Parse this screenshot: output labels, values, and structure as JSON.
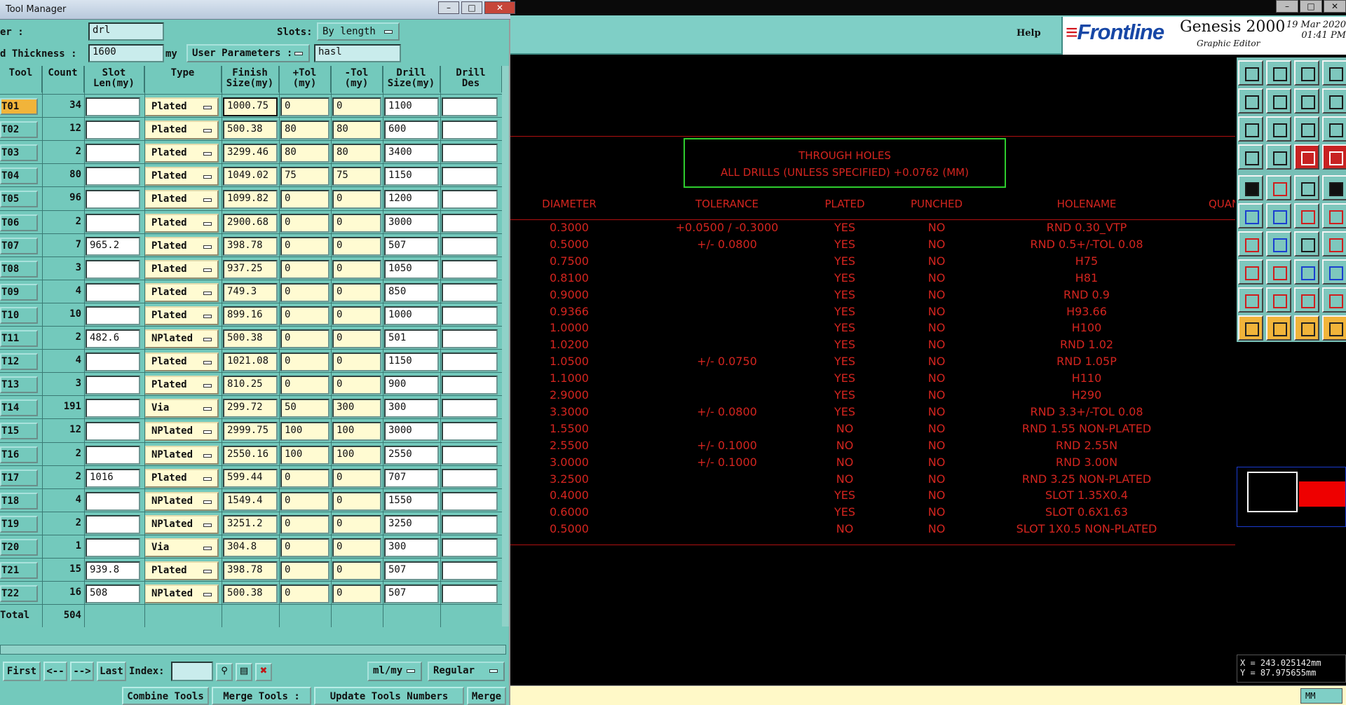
{
  "window_controls": {
    "min": "–",
    "max": "□",
    "close": "✕"
  },
  "genesis": {
    "help_label": "Help",
    "brand": "Frontline",
    "title": "Genesis 2000",
    "subtitle": "Graphic Editor",
    "date": "19 Mar 2020",
    "time": "01:41 PM",
    "colors": {
      "accent": "#7fcfc6",
      "drawing": "#d4251f",
      "frame": "#2ecc2e"
    },
    "drawing_title_line1": "THROUGH HOLES",
    "drawing_title_line2": "ALL DRILLS (UNLESS SPECIFIED) +0.0762 (MM)",
    "table_headers": [
      "DIAMETER",
      "TOLERANCE",
      "PLATED",
      "PUNCHED",
      "HOLENAME",
      "QUAN"
    ],
    "table_rows": [
      [
        "0.3000",
        "+0.0500 / -0.3000",
        "YES",
        "NO",
        "RND 0.30_VTP"
      ],
      [
        "0.5000",
        "+/- 0.0800",
        "YES",
        "NO",
        "RND 0.5+/-TOL 0.08"
      ],
      [
        "0.7500",
        "",
        "YES",
        "NO",
        "H75"
      ],
      [
        "0.8100",
        "",
        "YES",
        "NO",
        "H81"
      ],
      [
        "0.9000",
        "",
        "YES",
        "NO",
        "RND 0.9"
      ],
      [
        "0.9366",
        "",
        "YES",
        "NO",
        "H93.66"
      ],
      [
        "1.0000",
        "",
        "YES",
        "NO",
        "H100"
      ],
      [
        "1.0200",
        "",
        "YES",
        "NO",
        "RND 1.02"
      ],
      [
        "1.0500",
        "+/- 0.0750",
        "YES",
        "NO",
        "RND 1.05P"
      ],
      [
        "1.1000",
        "",
        "YES",
        "NO",
        "H110"
      ],
      [
        "2.9000",
        "",
        "YES",
        "NO",
        "H290"
      ],
      [
        "3.3000",
        "+/- 0.0800",
        "YES",
        "NO",
        "RND 3.3+/-TOL 0.08"
      ],
      [
        "1.5500",
        "",
        "NO",
        "NO",
        "RND 1.55 NON-PLATED"
      ],
      [
        "2.5500",
        "+/- 0.1000",
        "NO",
        "NO",
        "RND 2.55N"
      ],
      [
        "3.0000",
        "+/- 0.1000",
        "NO",
        "NO",
        "RND 3.00N"
      ],
      [
        "3.2500",
        "",
        "NO",
        "NO",
        "RND 3.25 NON-PLATED"
      ],
      [
        "0.4000",
        "",
        "YES",
        "NO",
        "SLOT 1.35X0.4"
      ],
      [
        "0.6000",
        "",
        "YES",
        "NO",
        "SLOT 0.6X1.63"
      ],
      [
        "0.5000",
        "",
        "NO",
        "NO",
        "SLOT 1X0.5 NON-PLATED"
      ]
    ],
    "coord_x": "X = 243.025142mm",
    "coord_y": "Y =  87.975655mm",
    "units_button": "MM"
  },
  "tool_manager": {
    "title": "Tool Manager",
    "layer_label": "er :",
    "layer_value": "drl",
    "slots_label": "Slots:",
    "slots_value": "By length",
    "thickness_label": "d Thickness :",
    "thickness_value": "1600",
    "thickness_unit": "my",
    "user_params_label": "User Parameters :",
    "user_params_value": "hasl",
    "columns": [
      "Tool",
      "Count",
      "Slot\nLen(my)",
      "Type",
      "Finish\nSize(my)",
      "+Tol\n(my)",
      "-Tol\n(my)",
      "Drill\nSize(my)",
      "Drill\nDes"
    ],
    "rows": [
      {
        "tool": "T01",
        "count": "34",
        "slot": "",
        "type": "Plated",
        "finish": "1000.75",
        "ptol": "0",
        "mtol": "0",
        "drill": "1100",
        "des": ""
      },
      {
        "tool": "T02",
        "count": "12",
        "slot": "",
        "type": "Plated",
        "finish": "500.38",
        "ptol": "80",
        "mtol": "80",
        "drill": "600",
        "des": ""
      },
      {
        "tool": "T03",
        "count": "2",
        "slot": "",
        "type": "Plated",
        "finish": "3299.46",
        "ptol": "80",
        "mtol": "80",
        "drill": "3400",
        "des": ""
      },
      {
        "tool": "T04",
        "count": "80",
        "slot": "",
        "type": "Plated",
        "finish": "1049.02",
        "ptol": "75",
        "mtol": "75",
        "drill": "1150",
        "des": ""
      },
      {
        "tool": "T05",
        "count": "96",
        "slot": "",
        "type": "Plated",
        "finish": "1099.82",
        "ptol": "0",
        "mtol": "0",
        "drill": "1200",
        "des": ""
      },
      {
        "tool": "T06",
        "count": "2",
        "slot": "",
        "type": "Plated",
        "finish": "2900.68",
        "ptol": "0",
        "mtol": "0",
        "drill": "3000",
        "des": ""
      },
      {
        "tool": "T07",
        "count": "7",
        "slot": "965.2",
        "type": "Plated",
        "finish": "398.78",
        "ptol": "0",
        "mtol": "0",
        "drill": "507",
        "des": ""
      },
      {
        "tool": "T08",
        "count": "3",
        "slot": "",
        "type": "Plated",
        "finish": "937.25",
        "ptol": "0",
        "mtol": "0",
        "drill": "1050",
        "des": ""
      },
      {
        "tool": "T09",
        "count": "4",
        "slot": "",
        "type": "Plated",
        "finish": "749.3",
        "ptol": "0",
        "mtol": "0",
        "drill": "850",
        "des": ""
      },
      {
        "tool": "T10",
        "count": "10",
        "slot": "",
        "type": "Plated",
        "finish": "899.16",
        "ptol": "0",
        "mtol": "0",
        "drill": "1000",
        "des": ""
      },
      {
        "tool": "T11",
        "count": "2",
        "slot": "482.6",
        "type": "NPlated",
        "finish": "500.38",
        "ptol": "0",
        "mtol": "0",
        "drill": "501",
        "des": ""
      },
      {
        "tool": "T12",
        "count": "4",
        "slot": "",
        "type": "Plated",
        "finish": "1021.08",
        "ptol": "0",
        "mtol": "0",
        "drill": "1150",
        "des": ""
      },
      {
        "tool": "T13",
        "count": "3",
        "slot": "",
        "type": "Plated",
        "finish": "810.25",
        "ptol": "0",
        "mtol": "0",
        "drill": "900",
        "des": ""
      },
      {
        "tool": "T14",
        "count": "191",
        "slot": "",
        "type": "Via",
        "finish": "299.72",
        "ptol": "50",
        "mtol": "300",
        "drill": "300",
        "des": ""
      },
      {
        "tool": "T15",
        "count": "12",
        "slot": "",
        "type": "NPlated",
        "finish": "2999.75",
        "ptol": "100",
        "mtol": "100",
        "drill": "3000",
        "des": ""
      },
      {
        "tool": "T16",
        "count": "2",
        "slot": "",
        "type": "NPlated",
        "finish": "2550.16",
        "ptol": "100",
        "mtol": "100",
        "drill": "2550",
        "des": ""
      },
      {
        "tool": "T17",
        "count": "2",
        "slot": "1016",
        "type": "Plated",
        "finish": "599.44",
        "ptol": "0",
        "mtol": "0",
        "drill": "707",
        "des": ""
      },
      {
        "tool": "T18",
        "count": "4",
        "slot": "",
        "type": "NPlated",
        "finish": "1549.4",
        "ptol": "0",
        "mtol": "0",
        "drill": "1550",
        "des": ""
      },
      {
        "tool": "T19",
        "count": "2",
        "slot": "",
        "type": "NPlated",
        "finish": "3251.2",
        "ptol": "0",
        "mtol": "0",
        "drill": "3250",
        "des": ""
      },
      {
        "tool": "T20",
        "count": "1",
        "slot": "",
        "type": "Via",
        "finish": "304.8",
        "ptol": "0",
        "mtol": "0",
        "drill": "300",
        "des": ""
      },
      {
        "tool": "T21",
        "count": "15",
        "slot": "939.8",
        "type": "Plated",
        "finish": "398.78",
        "ptol": "0",
        "mtol": "0",
        "drill": "507",
        "des": ""
      },
      {
        "tool": "T22",
        "count": "16",
        "slot": "508",
        "type": "NPlated",
        "finish": "500.38",
        "ptol": "0",
        "mtol": "0",
        "drill": "507",
        "des": ""
      }
    ],
    "total_label": "Total",
    "total_count": "504",
    "nav": {
      "first": "First",
      "prev": "<--",
      "next": "-->",
      "last": "Last",
      "index_label": "Index:",
      "index_value": "",
      "units": "ml/my",
      "mode": "Regular"
    },
    "actions": {
      "combine": "Combine Tools",
      "merge_tools": "Merge Tools :",
      "update": "Update Tools Numbers",
      "merge": "Merge"
    }
  }
}
